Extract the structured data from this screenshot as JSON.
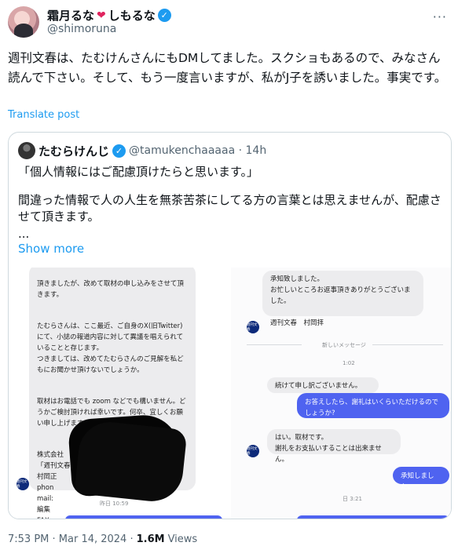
{
  "author": {
    "display_name": "霜月るな",
    "display_name_suffix": "しもるな",
    "heart_glyph": "❤",
    "handle": "@shimoruna",
    "verified_glyph": "✓"
  },
  "more_glyph": "···",
  "post": {
    "text": "週刊文春は、たむけんさんにもDMしてました。スクショもあるので、みなさん読んで下さい。そして、もう一度言いますが、私がJ子を誘いました。事実です。",
    "translate_label": "Translate post"
  },
  "quote": {
    "name": "たむらけんじ",
    "handle_time": "@tamukenchaaaaa · 14h",
    "text1": "「個人情報にはご配慮頂けたらと思います。」",
    "text2": "間違った情報で人の人生を無茶苦茶にしてる方の言葉とは思えませんが、配慮させて頂きます。",
    "ellipsis": "...",
    "show_more": "Show more",
    "left_screenshot": {
      "top_text": "頂きましたが、改めて取材の申し込みをさせて頂きます。",
      "para1": "たむらさんは、ここ最近、ご自身のX(旧Twitter)にて、小誌の報道内容に対して異議を唱えられていることと存じます。\nつきましては、改めてたむらさんのご見解を私どもにお聞かせ頂けないでしょうか。",
      "para2": "取材はお電話でも zoom などでも構いません。どうかご検討頂ければ幸いです。何卒、宜しくお願い申し上げます。",
      "sig": "株式会社　文藝春秋\n「週刊文春\n村岡正\nphon\nmail:\n編集\nFAX",
      "timestamp": "昨日 10:59",
      "logo_text": "週刊文春"
    },
    "right_screenshot": {
      "msg1": "承知致しました。\nお忙しいところお返事頂きありがとうございました。\n\n週刊文春　村岡拝",
      "new_messages": "新しいメッセージ",
      "time1": "1:02",
      "msg2": "続けて申し訳ございません。",
      "msg3": "お答えしたら、謝礼はいくらいただけるのでしょうか?",
      "msg4": "はい。取材です。\n謝礼をお支払いすることは出来ません。",
      "msg5": "承知しました。",
      "time2": "日 3:21",
      "logo_text": "週刊文春"
    }
  },
  "meta": {
    "time": "7:53 PM · Mar 14, 2024 ·",
    "views_count": "1.6M",
    "views_label": "Views"
  }
}
